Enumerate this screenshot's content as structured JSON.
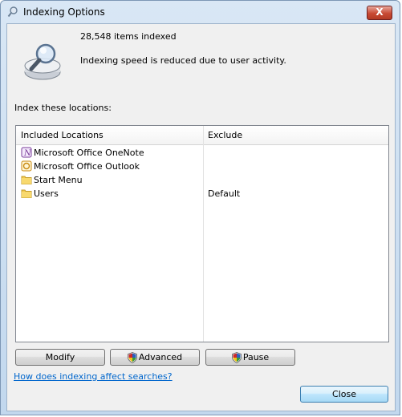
{
  "window": {
    "title": "Indexing Options",
    "close_glyph": "X"
  },
  "status": {
    "items_indexed": "28,548 items indexed",
    "message": "Indexing speed is reduced due to user activity."
  },
  "locations_label": "Index these locations:",
  "table": {
    "columns": [
      "Included Locations",
      "Exclude"
    ],
    "rows": [
      {
        "name": "Microsoft Office OneNote",
        "exclude": "",
        "icon": "onenote-icon"
      },
      {
        "name": "Microsoft Office Outlook",
        "exclude": "",
        "icon": "outlook-icon"
      },
      {
        "name": "Start Menu",
        "exclude": "",
        "icon": "folder-icon"
      },
      {
        "name": "Users",
        "exclude": "Default",
        "icon": "folder-icon"
      }
    ]
  },
  "buttons": {
    "modify": "Modify",
    "advanced": "Advanced",
    "pause": "Pause",
    "close": "Close"
  },
  "help_link": "How does indexing affect searches?",
  "colors": {
    "link": "#0066cc",
    "shield_red": "#cc2a2a",
    "shield_blue": "#2b5fbf",
    "shield_yellow": "#f2c21b",
    "shield_green": "#3a9a3a"
  }
}
